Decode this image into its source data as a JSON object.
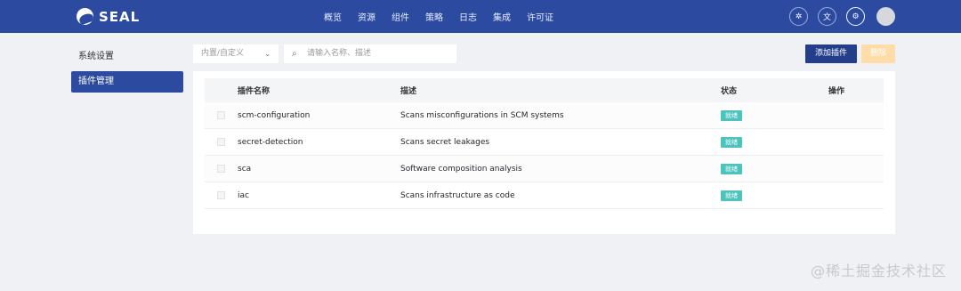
{
  "brand": {
    "name": "SEAL"
  },
  "nav": {
    "items": [
      "概览",
      "资源",
      "组件",
      "策略",
      "日志",
      "集成",
      "许可证"
    ]
  },
  "top_actions": {
    "icons": [
      "bug-icon",
      "translate-icon",
      "settings-icon"
    ]
  },
  "sidebar": {
    "items": [
      {
        "label": "系统设置"
      },
      {
        "label": "插件管理"
      }
    ]
  },
  "toolbar": {
    "filter_value": "内置/自定义",
    "search_placeholder": "请输入名称、描述",
    "add_label": "添加插件",
    "delete_label": "删除"
  },
  "table": {
    "columns": [
      "插件名称",
      "描述",
      "状态",
      "操作"
    ],
    "rows": [
      {
        "name": "scm-configuration",
        "desc": "Scans misconfigurations in SCM systems",
        "status": "就绪"
      },
      {
        "name": "secret-detection",
        "desc": "Scans secret leakages",
        "status": "就绪"
      },
      {
        "name": "sca",
        "desc": "Software composition analysis",
        "status": "就绪"
      },
      {
        "name": "iac",
        "desc": "Scans infrastructure as code",
        "status": "就绪"
      }
    ]
  },
  "watermark": "@稀土掘金技术社区",
  "colors": {
    "primary": "#2b4aa0",
    "success": "#4cc3bd",
    "danger_disabled": "#ffdca8"
  }
}
